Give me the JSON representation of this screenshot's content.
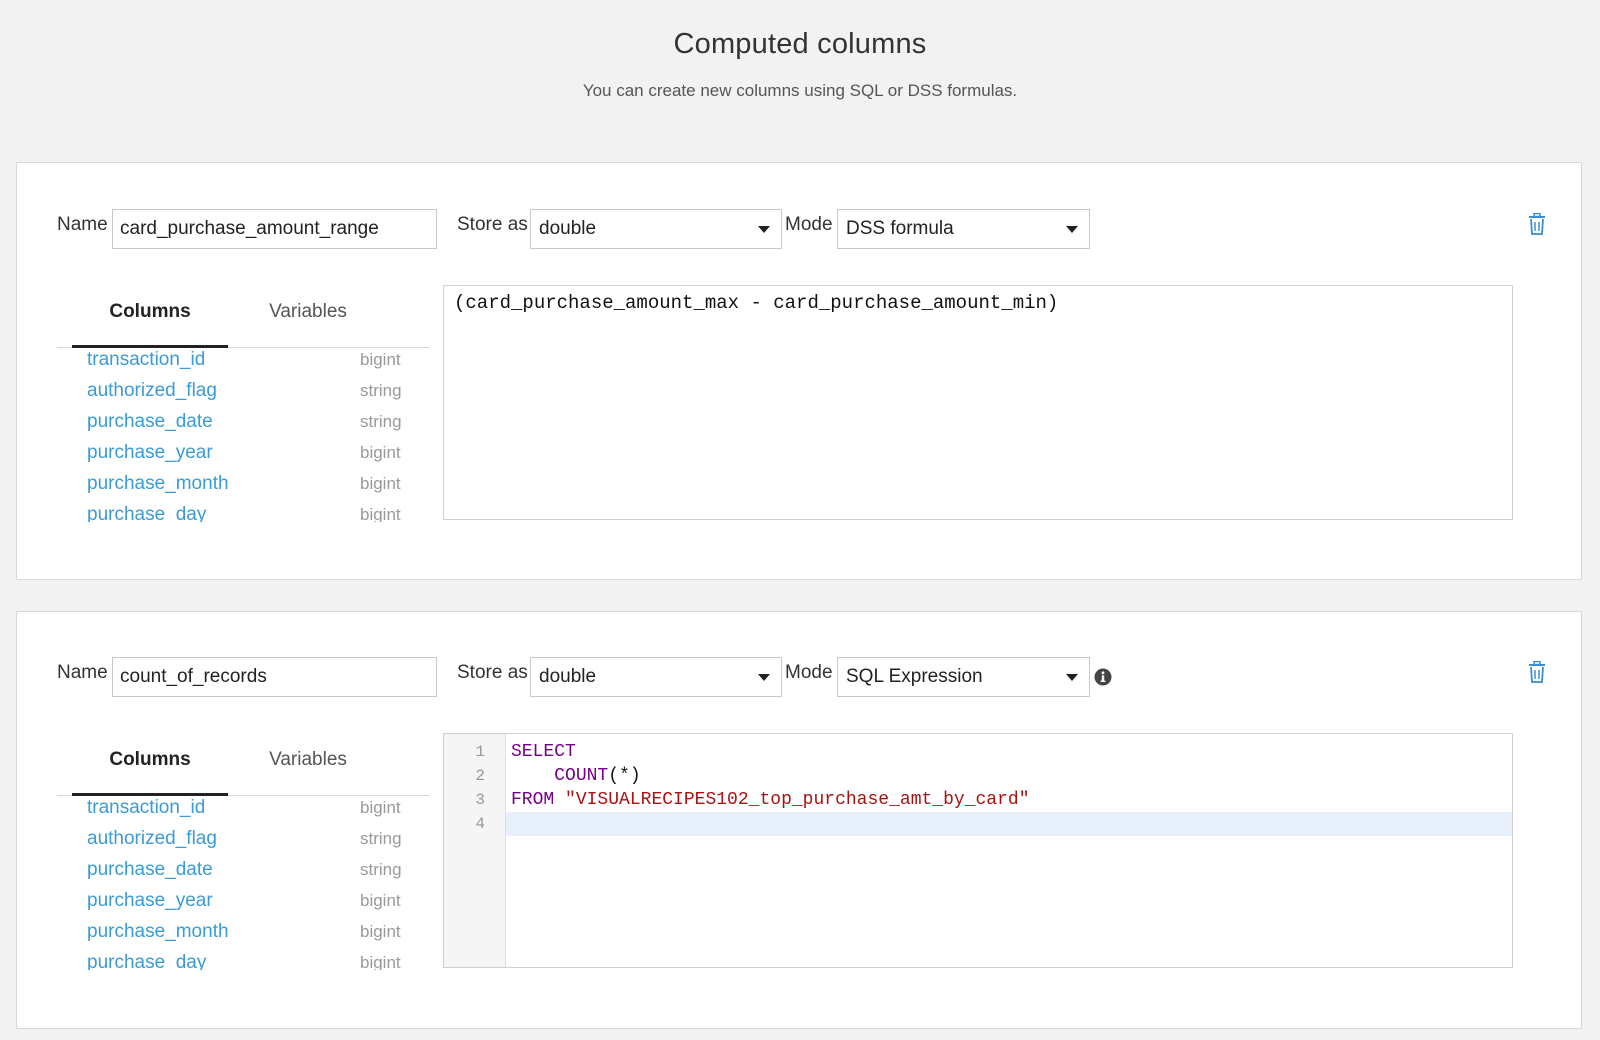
{
  "header": {
    "title": "Computed columns",
    "subtitle": "You can create new columns using SQL or DSS formulas."
  },
  "labels": {
    "name": "Name",
    "store_as": "Store as",
    "mode": "Mode"
  },
  "tabs": {
    "columns": "Columns",
    "variables": "Variables"
  },
  "column_list": [
    {
      "name": "transaction_id",
      "type": "bigint"
    },
    {
      "name": "authorized_flag",
      "type": "string"
    },
    {
      "name": "purchase_date",
      "type": "string"
    },
    {
      "name": "purchase_year",
      "type": "bigint"
    },
    {
      "name": "purchase_month",
      "type": "bigint"
    },
    {
      "name": "purchase_day",
      "type": "bigint"
    }
  ],
  "computed_columns": [
    {
      "name": "card_purchase_amount_range",
      "store_as": "double",
      "mode": "DSS formula",
      "formula": "(card_purchase_amount_max - card_purchase_amount_min)"
    },
    {
      "name": "count_of_records",
      "store_as": "double",
      "mode": "SQL Expression",
      "line_numbers": [
        "1",
        "2",
        "3",
        "4"
      ],
      "sql": {
        "select_kw": "SELECT",
        "count_fn": "COUNT",
        "count_args": "(*)",
        "from_kw": "FROM",
        "table_str": "\"VISUALRECIPES102_top_purchase_amt_by_card\""
      }
    }
  ],
  "colors": {
    "background": "#f2f2f2",
    "link_blue": "#3a9bd8",
    "sql_keyword": "#770088",
    "sql_string": "#aa1111",
    "active_line": "#e8f0fb",
    "trash_icon": "#3a8fd0"
  },
  "icons": {
    "delete": "trash-icon",
    "info": "info-icon",
    "dropdown": "caret-down-icon"
  }
}
